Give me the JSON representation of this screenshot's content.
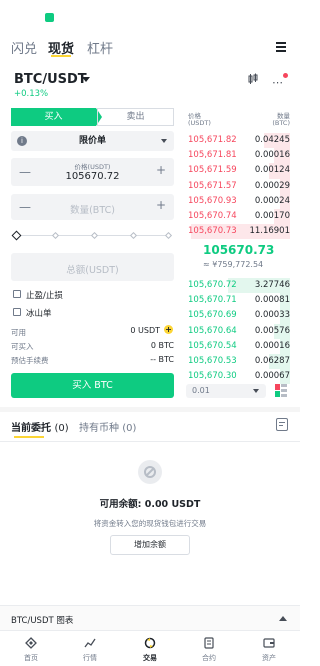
{
  "top_nav": {
    "tabs": [
      "闪兑",
      "现货",
      "杠杆"
    ],
    "active": 1
  },
  "pair": {
    "name": "BTC/USDT",
    "change": "+0.13%"
  },
  "trade_tabs": {
    "buy": "买入",
    "sell": "卖出"
  },
  "order_form": {
    "order_type": "限价单",
    "price_label": "价格(USDT)",
    "price_value": "105670.72",
    "amount_placeholder": "数量(BTC)",
    "total_placeholder": "总额(USDT)",
    "tp_sl_label": "止盈/止损",
    "iceberg_label": "冰山单",
    "available_label": "可用",
    "available_value": "0 USDT",
    "can_buy_label": "可买入",
    "can_buy_value": "0 BTC",
    "fee_label": "预估手续费",
    "fee_value": "-- BTC",
    "buy_button": "买入 BTC"
  },
  "order_book": {
    "price_header": "价格",
    "price_unit": "(USDT)",
    "qty_header": "数量",
    "qty_unit": "(BTC)",
    "asks": [
      {
        "price": "105,671.82",
        "qty": "0.04245",
        "depth": 0.25
      },
      {
        "price": "105,671.81",
        "qty": "0.00016",
        "depth": 0.15
      },
      {
        "price": "105,671.59",
        "qty": "0.00124",
        "depth": 0.2
      },
      {
        "price": "105,671.57",
        "qty": "0.00029",
        "depth": 0.1
      },
      {
        "price": "105,670.93",
        "qty": "0.00024",
        "depth": 0.1
      },
      {
        "price": "105,670.74",
        "qty": "0.00170",
        "depth": 0.15
      },
      {
        "price": "105,670.73",
        "qty": "11.16901",
        "depth": 0.95
      }
    ],
    "last_price": "105670.73",
    "last_price_fiat": "≈ ¥759,772.54",
    "bids": [
      {
        "price": "105,670.72",
        "qty": "3.27746",
        "depth": 0.6
      },
      {
        "price": "105,670.71",
        "qty": "0.00081",
        "depth": 0.1
      },
      {
        "price": "105,670.69",
        "qty": "0.00033",
        "depth": 0.1
      },
      {
        "price": "105,670.64",
        "qty": "0.00576",
        "depth": 0.15
      },
      {
        "price": "105,670.54",
        "qty": "0.00016",
        "depth": 0.1
      },
      {
        "price": "105,670.53",
        "qty": "0.06287",
        "depth": 0.2
      },
      {
        "price": "105,670.30",
        "qty": "0.00067",
        "depth": 0.1
      }
    ],
    "precision": "0.01"
  },
  "orders_section": {
    "tab_current": "当前委托",
    "tab_current_count": "(0)",
    "tab_holdings": "持有币种",
    "tab_holdings_count": "(0)",
    "available_balance_label": "可用余额:",
    "available_balance_value": "0.00 USDT",
    "hint": "将资金转入您的现货钱包进行交易",
    "add_funds": "增加余额"
  },
  "chart_bar": {
    "label": "BTC/USDT 图表"
  },
  "bottom_nav": [
    {
      "label": "首页",
      "icon": "home-icon"
    },
    {
      "label": "行情",
      "icon": "markets-icon"
    },
    {
      "label": "交易",
      "icon": "trade-icon",
      "active": true
    },
    {
      "label": "合约",
      "icon": "futures-icon"
    },
    {
      "label": "资产",
      "icon": "wallet-icon"
    }
  ],
  "colors": {
    "accent": "#0ecb81",
    "sell": "#f6465d",
    "brand": "#fcd535"
  }
}
